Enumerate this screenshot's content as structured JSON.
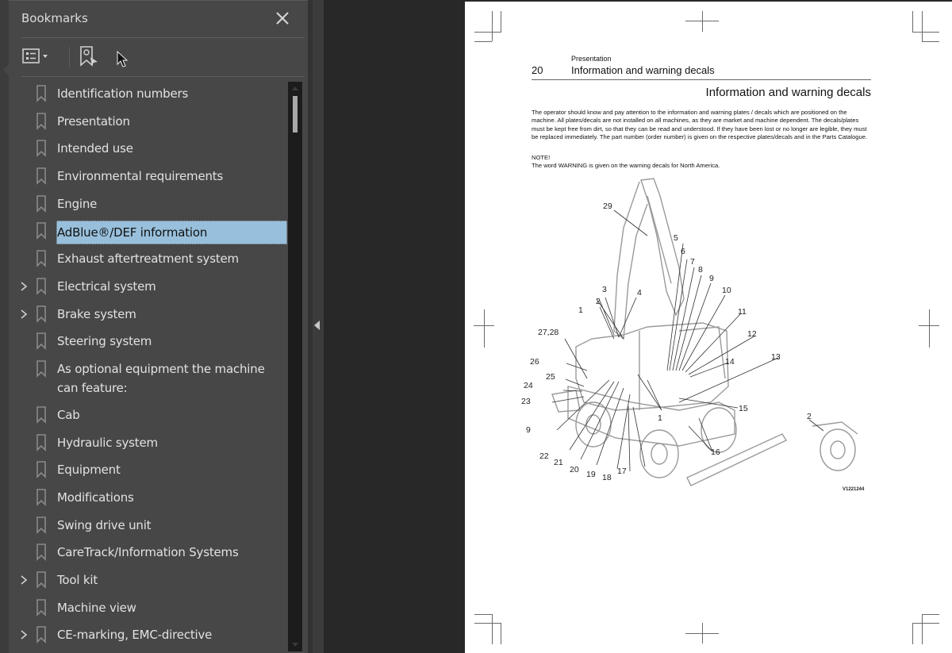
{
  "bookmarks_panel": {
    "title": "Bookmarks",
    "close_icon": "close-icon",
    "toolbar": {
      "options_icon": "list-options-icon",
      "find_icon": "find-current-bookmark-icon"
    },
    "items": [
      {
        "label": "Identification numbers",
        "expandable": false
      },
      {
        "label": "Presentation",
        "expandable": false
      },
      {
        "label": "Intended use",
        "expandable": false
      },
      {
        "label": "Environmental requirements",
        "expandable": false
      },
      {
        "label": "Engine",
        "expandable": false
      },
      {
        "label": "AdBlue®/DEF information",
        "expandable": false,
        "selected": true
      },
      {
        "label": "Exhaust aftertreatment system",
        "expandable": false
      },
      {
        "label": "Electrical system",
        "expandable": true
      },
      {
        "label": "Brake system",
        "expandable": true
      },
      {
        "label": "Steering system",
        "expandable": false
      },
      {
        "label": "As optional equipment the machine can feature:",
        "expandable": false
      },
      {
        "label": "Cab",
        "expandable": false
      },
      {
        "label": "Hydraulic system",
        "expandable": false
      },
      {
        "label": "Equipment",
        "expandable": false
      },
      {
        "label": "Modifications",
        "expandable": false
      },
      {
        "label": "Swing drive unit",
        "expandable": false
      },
      {
        "label": "CareTrack/Information Systems",
        "expandable": false
      },
      {
        "label": "Tool kit",
        "expandable": true
      },
      {
        "label": "Machine view",
        "expandable": false
      },
      {
        "label": "CE-marking, EMC-directive",
        "expandable": true
      }
    ],
    "selection_color": "#98c0dc"
  },
  "document": {
    "section": "Presentation",
    "page_number": "20",
    "header_title": "Information and warning decals",
    "heading": "Information and warning decals",
    "body": "The operator should know and pay attention to the information and warning plates / decals which are positioned on the machine. All plates/decals are not installed on all machines, as they are market and machine dependent. The decals/plates must be kept free from dirt, so that they can be read and understood. If they have been lost or no longer are legible, they must be replaced immediately. The part number (order number) is given on the respective plates/decals and in the Parts Catalogue.",
    "note_label": "NOTE!",
    "note_text": "The word WARNING is given on the warning decals for North America.",
    "figure": {
      "id": "V1221244",
      "callouts": [
        "29",
        "5",
        "6",
        "7",
        "8",
        "9",
        "10",
        "3",
        "2",
        "4",
        "1",
        "11",
        "27,28",
        "12",
        "13",
        "26",
        "14",
        "25",
        "24",
        "23",
        "15",
        "9",
        "1",
        "2",
        "16",
        "22",
        "21",
        "20",
        "19",
        "18",
        "17"
      ]
    }
  }
}
